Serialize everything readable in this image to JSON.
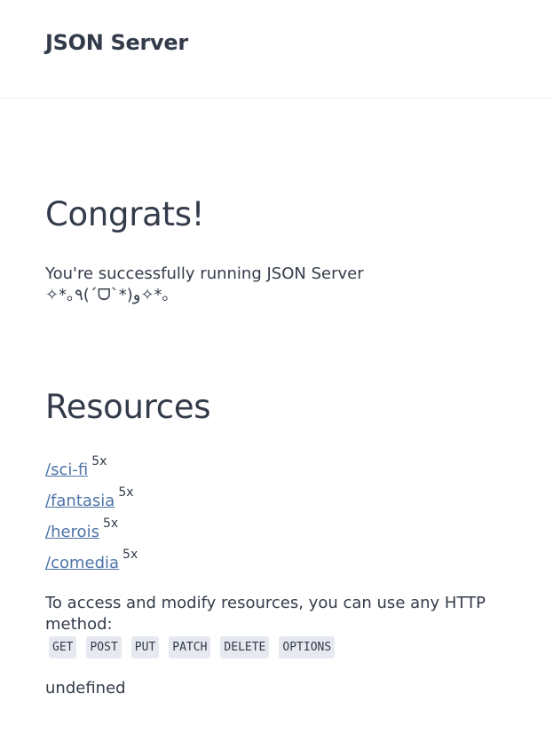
{
  "header": {
    "title": "JSON Server"
  },
  "congrats": {
    "heading": "Congrats!",
    "line1": "You're successfully running JSON Server",
    "line2": "✧*｡٩(ˊᗜˋ*)و✧*｡"
  },
  "resources": {
    "heading": "Resources",
    "items": [
      {
        "path": "/sci-fi",
        "count": "5x"
      },
      {
        "path": "/fantasia",
        "count": "5x"
      },
      {
        "path": "/herois",
        "count": "5x"
      },
      {
        "path": "/comedia",
        "count": "5x"
      }
    ],
    "info": "To access and modify resources, you can use any HTTP method:",
    "methods": [
      "GET",
      "POST",
      "PUT",
      "PATCH",
      "DELETE",
      "OPTIONS"
    ],
    "footer": "undefined"
  }
}
